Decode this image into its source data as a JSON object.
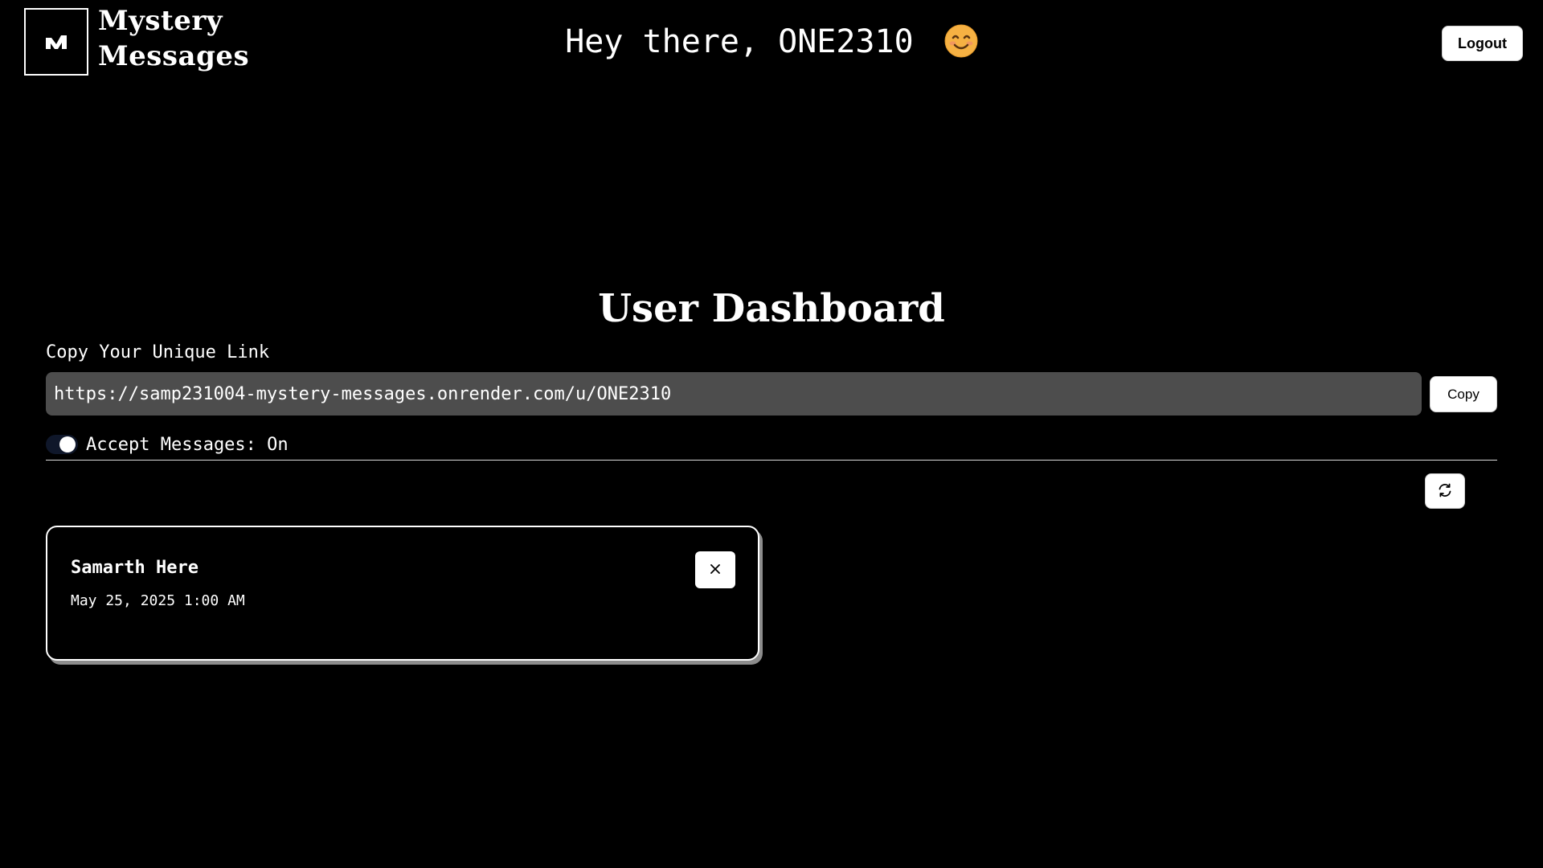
{
  "header": {
    "brand_line1": "Mystery",
    "brand_line2": "Messages",
    "greeting": "Hey there, ONE2310",
    "greeting_emoji": "smiling-face-emoji",
    "logout_label": "Logout"
  },
  "dashboard": {
    "title": "User Dashboard",
    "link_label": "Copy Your Unique Link",
    "link_value": "https://samp231004-mystery-messages.onrender.com/u/ONE2310",
    "copy_label": "Copy",
    "accept_messages_label": "Accept Messages: On",
    "accept_messages_enabled": true,
    "refresh_icon": "refresh-icon"
  },
  "messages": [
    {
      "title": "Samarth Here",
      "date": "May 25, 2025 1:00 AM",
      "delete_icon": "close-icon"
    }
  ],
  "colors": {
    "background": "#000000",
    "foreground": "#ffffff",
    "input_background": "#4d4d4d",
    "switch_track": "#0f172a",
    "emoji_face": "#f6b143"
  }
}
